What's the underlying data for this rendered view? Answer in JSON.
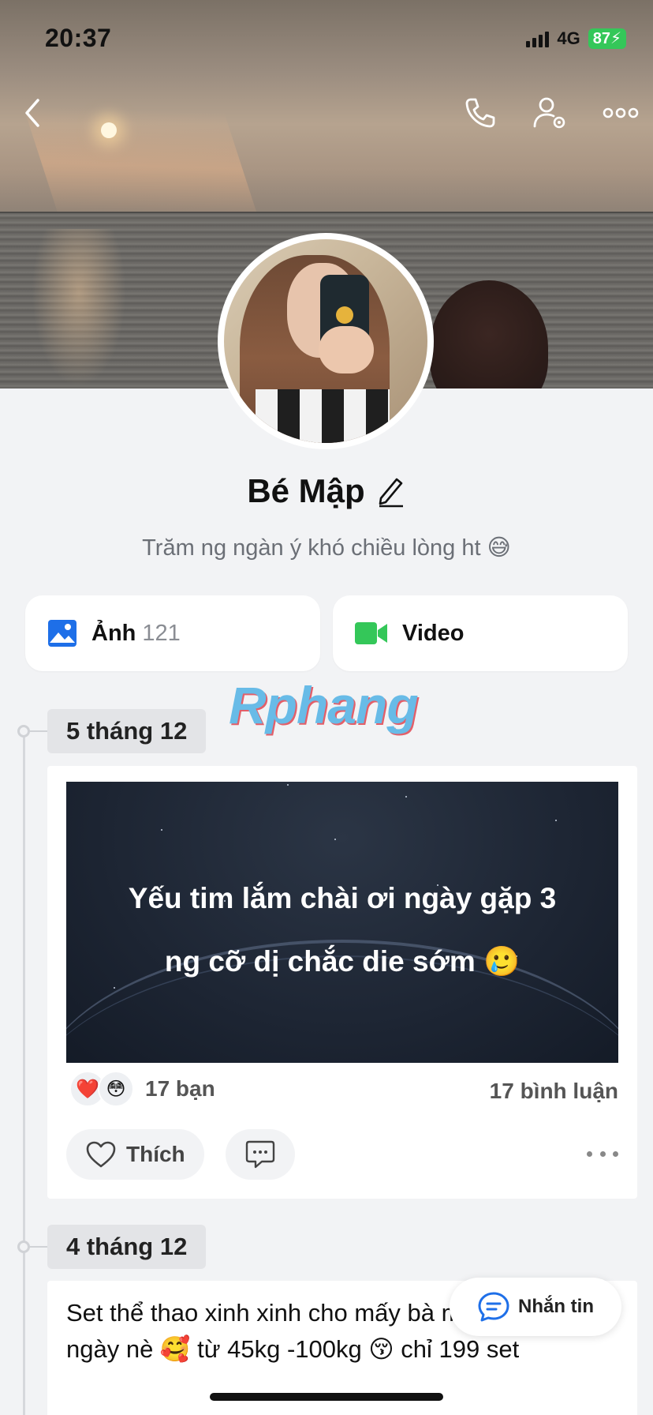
{
  "status_bar": {
    "time": "20:37",
    "network": "4G",
    "battery": "87"
  },
  "profile": {
    "name": "Bé Mập",
    "bio": "Trăm ng ngàn ý khó chiều lòng ht 😅"
  },
  "media": {
    "photos_label": "Ảnh",
    "photos_count": "121",
    "video_label": "Video"
  },
  "watermark": "Rphang",
  "posts": [
    {
      "date": "5 tháng 12",
      "text_line1": "Yếu tim lắm chài ơi ngày gặp 3",
      "text_line2": "ng cỡ dị chắc die sớm 🥲",
      "reaction_emojis": [
        "❤️",
        "😳"
      ],
      "reactions_count": "17 bạn",
      "comments_count": "17 bình luận",
      "like_label": "Thích"
    },
    {
      "date": "4 tháng 12",
      "text": "Set thể thao xinh xinh cho mấy bà mặc thường ngày nè 🥰 từ 45kg -100kg 😚 chỉ 199 set"
    }
  ],
  "message_button": {
    "label": "Nhắn tin"
  },
  "colors": {
    "accent": "#1e6fe8",
    "video_green": "#34c759",
    "battery_green": "#34c759"
  }
}
